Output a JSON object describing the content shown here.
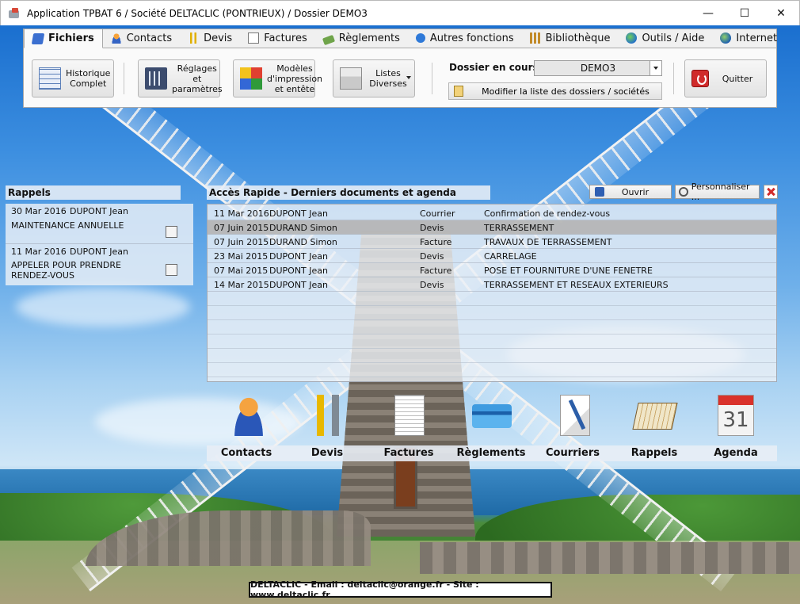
{
  "window": {
    "title": "Application TPBAT 6 / Société DELTACLIC (PONTRIEUX) / Dossier DEMO3"
  },
  "tabs": [
    {
      "label": "Fichiers",
      "icon": "files-icon"
    },
    {
      "label": "Contacts",
      "icon": "person-icon"
    },
    {
      "label": "Devis",
      "icon": "tools-icon"
    },
    {
      "label": "Factures",
      "icon": "document-icon"
    },
    {
      "label": "Règlements",
      "icon": "money-icon"
    },
    {
      "label": "Autres fonctions",
      "icon": "gear-icon"
    },
    {
      "label": "Bibliothèque",
      "icon": "books-icon"
    },
    {
      "label": "Outils / Aide",
      "icon": "globe-icon"
    },
    {
      "label": "Internet",
      "icon": "internet-icon"
    }
  ],
  "ribbon": {
    "historique": "Historique Complet",
    "reglages": "Réglages et paramètres",
    "modeles": "Modèles d'impression et entête",
    "listes": "Listes Diverses",
    "dossier_label": "Dossier en cours :",
    "dossier_value": "DEMO3",
    "modifier": "Modifier la liste des dossiers / sociétés",
    "quitter": "Quitter"
  },
  "rappels": {
    "title": "Rappels",
    "items": [
      {
        "date": "30 Mar 2016",
        "name": "DUPONT Jean",
        "text": "MAINTENANCE ANNUELLE"
      },
      {
        "date": "11 Mar 2016",
        "name": "DUPONT Jean",
        "text": "APPELER POUR PRENDRE RENDEZ-VOUS"
      }
    ]
  },
  "acces": {
    "title": "Accès Rapide - Derniers documents et agenda",
    "ouvrir": "Ouvrir",
    "personnaliser": "Personnaliser ...",
    "rows": [
      {
        "date": "11 Mar 2016",
        "name": "DUPONT Jean",
        "type": "Courrier",
        "object": "Confirmation de rendez-vous",
        "selected": false
      },
      {
        "date": "07 Juin 2015",
        "name": "DURAND Simon",
        "type": "Devis",
        "object": "TERRASSEMENT",
        "selected": true
      },
      {
        "date": "07 Juin 2015",
        "name": "DURAND Simon",
        "type": "Facture",
        "object": "TRAVAUX DE TERRASSEMENT",
        "selected": false
      },
      {
        "date": "23 Mai 2015",
        "name": "DUPONT Jean",
        "type": "Devis",
        "object": "CARRELAGE",
        "selected": false
      },
      {
        "date": "07 Mai 2015",
        "name": "DUPONT Jean",
        "type": "Facture",
        "object": "POSE ET FOURNITURE D'UNE FENETRE",
        "selected": false
      },
      {
        "date": "14 Mar 2015",
        "name": "DUPONT Jean",
        "type": "Devis",
        "object": "TERRASSEMENT ET RESEAUX EXTERIEURS",
        "selected": false
      }
    ]
  },
  "launch": [
    {
      "label": "Contacts",
      "icon": "contacts-icon"
    },
    {
      "label": "Devis",
      "icon": "devis-icon"
    },
    {
      "label": "Factures",
      "icon": "factures-icon"
    },
    {
      "label": "Règlements",
      "icon": "reglements-icon"
    },
    {
      "label": "Courriers",
      "icon": "courriers-icon"
    },
    {
      "label": "Rappels",
      "icon": "rappels-icon"
    },
    {
      "label": "Agenda",
      "icon": "agenda-icon",
      "badge": "31"
    }
  ],
  "footer": "DELTACLIC  -  Email : deltaclic@orange.fr - Site : www.deltaclic.fr"
}
